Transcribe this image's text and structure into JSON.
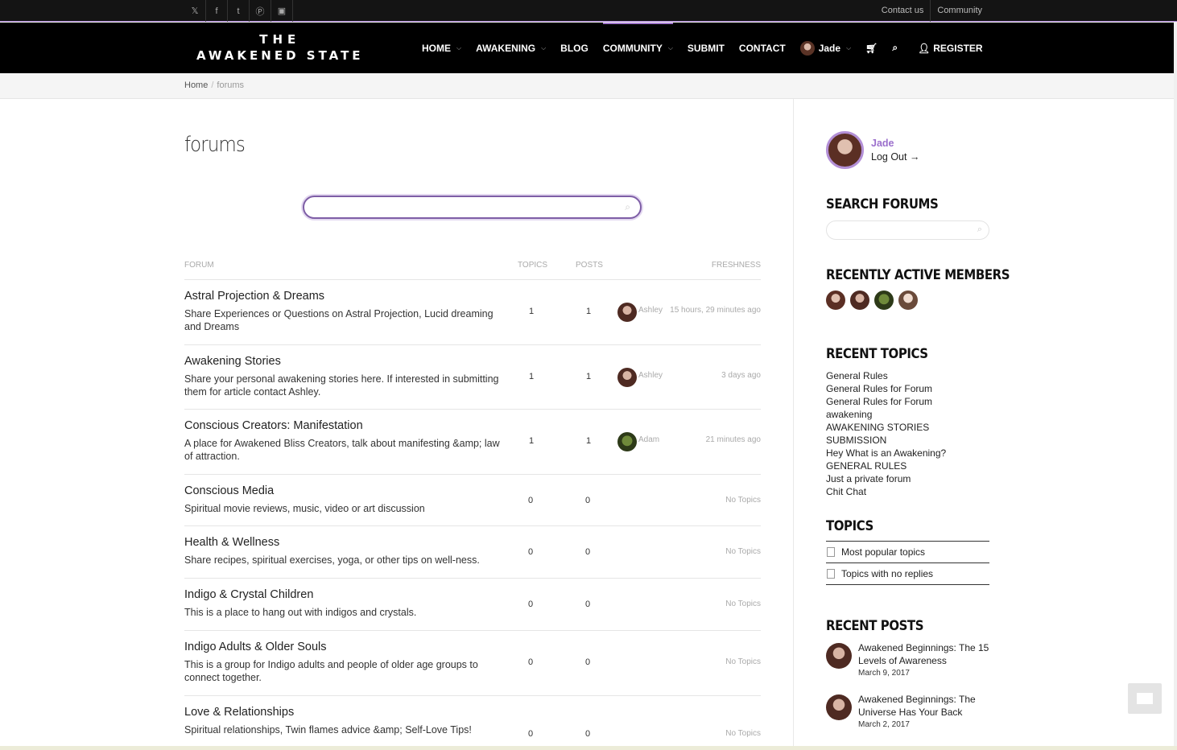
{
  "topbar": {
    "social_icons": [
      "twitter-icon",
      "facebook-icon",
      "tumblr-icon",
      "pinterest-icon",
      "instagram-icon"
    ],
    "links": [
      "Contact us",
      "Community"
    ]
  },
  "logo": {
    "line1": "THE",
    "line2": "AWAKENED STATE"
  },
  "nav": {
    "items": [
      {
        "label": "HOME",
        "dropdown": true
      },
      {
        "label": "AWAKENING",
        "dropdown": true
      },
      {
        "label": "BLOG",
        "dropdown": false
      },
      {
        "label": "COMMUNITY",
        "dropdown": true,
        "active": true
      },
      {
        "label": "SUBMIT",
        "dropdown": false
      },
      {
        "label": "CONTACT",
        "dropdown": false
      }
    ],
    "user": "Jade",
    "register": "REGISTER"
  },
  "breadcrumb": {
    "home": "Home",
    "sep": "/",
    "current": "forums"
  },
  "page_title": "forums",
  "main_search": {
    "placeholder": ""
  },
  "table": {
    "headers": {
      "forum": "FORUM",
      "topics": "TOPICS",
      "posts": "POSTS",
      "freshness": "FRESHNESS"
    },
    "rows": [
      {
        "name": "Astral Projection & Dreams",
        "desc": "Share Experiences or Questions on Astral Projection, Lucid dreaming and Dreams",
        "topics": "1",
        "posts": "1",
        "fresh_user": "Ashley",
        "fresh_time": "15 hours, 29 minutes ago"
      },
      {
        "name": "Awakening Stories",
        "desc": "Share your personal awakening stories here. If interested in submitting them for article contact Ashley.",
        "topics": "1",
        "posts": "1",
        "fresh_user": "Ashley",
        "fresh_time": "3 days ago"
      },
      {
        "name": "Conscious Creators: Manifestation",
        "desc": "A place for Awakened Bliss Creators, talk about manifesting &amp; law of attraction.",
        "topics": "1",
        "posts": "1",
        "fresh_user": "Adam",
        "fresh_time": "21 minutes ago"
      },
      {
        "name": "Conscious Media",
        "desc": "Spiritual movie reviews, music, video or art discussion",
        "topics": "0",
        "posts": "0",
        "fresh_user": "",
        "fresh_time": "No Topics"
      },
      {
        "name": "Health & Wellness",
        "desc": "Share recipes, spiritual exercises, yoga, or other tips on well-ness.",
        "topics": "0",
        "posts": "0",
        "fresh_user": "",
        "fresh_time": "No Topics"
      },
      {
        "name": "Indigo & Crystal Children",
        "desc": "This is a place to hang out with indigos and crystals.",
        "topics": "0",
        "posts": "0",
        "fresh_user": "",
        "fresh_time": "No Topics"
      },
      {
        "name": "Indigo Adults & Older Souls",
        "desc": "This is a group for Indigo adults and people of older age groups to connect together.",
        "topics": "0",
        "posts": "0",
        "fresh_user": "",
        "fresh_time": "No Topics"
      },
      {
        "name": "Love & Relationships",
        "desc": "Spiritual relationships, Twin flames advice &amp; Self-Love Tips!",
        "topics": "0",
        "posts": "0",
        "fresh_user": "",
        "fresh_time": "No Topics"
      }
    ]
  },
  "sidebar": {
    "user": "Jade",
    "logout": "Log Out →",
    "search_title": "SEARCH FORUMS",
    "members_title": "RECENTLY ACTIVE MEMBERS",
    "recent_topics_title": "RECENT TOPICS",
    "recent_topics": [
      "General Rules",
      "General Rules for Forum",
      "General Rules for Forum",
      "awakening",
      "AWAKENING STORIES SUBMISSION",
      "Hey What is an Awakening?",
      "GENERAL RULES",
      "Just a private forum",
      "Chit Chat"
    ],
    "topics_title": "TOPICS",
    "topics_links": [
      "Most popular topics",
      "Topics with no replies"
    ],
    "recent_posts_title": "RECENT POSTS",
    "recent_posts": [
      {
        "title": "Awakened Beginnings: The 15 Levels of Awareness",
        "date": "March 9, 2017"
      },
      {
        "title": "Awakened Beginnings: The Universe Has Your Back",
        "date": "March 2, 2017"
      }
    ]
  },
  "colors": {
    "accent": "#a57bd0",
    "header_bg": "#000000"
  }
}
